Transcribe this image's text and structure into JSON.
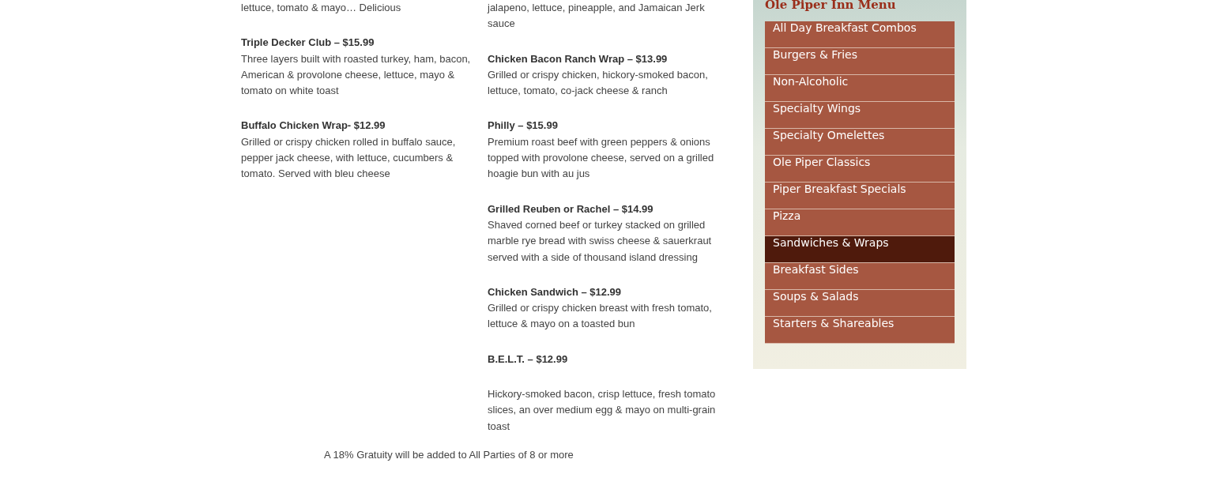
{
  "menu_columns": [
    {
      "items": [
        {
          "description": "lettuce, tomato & mayo… Delicious"
        },
        {
          "title": "Triple Decker Club – $15.99",
          "description": "Three layers built with roasted turkey, ham, bacon, American & provolone cheese, lettuce, mayo & tomato on white toast"
        },
        {
          "title": "Buffalo Chicken Wrap- $12.99",
          "description": "Grilled or crispy chicken rolled in buffalo sauce, pepper jack cheese, with lettuce, cucumbers & tomato. Served with bleu cheese"
        }
      ]
    },
    {
      "items": [
        {
          "description": "jalapeno, lettuce, pineapple, and Jamaican Jerk sauce"
        },
        {
          "title": "Chicken Bacon Ranch Wrap – $13.99",
          "description": "Grilled or crispy chicken, hickory-smoked bacon, lettuce, tomato, co-jack cheese & ranch"
        },
        {
          "title": "Philly – $15.99",
          "description": "Premium roast beef with green peppers & onions topped with provolone cheese, served on a grilled hoagie bun with au jus"
        },
        {
          "title": "Grilled Reuben or Rachel – $14.99",
          "description": "Shaved corned beef or turkey stacked on grilled marble rye bread with swiss cheese & sauerkraut served with a side of thousand island dressing"
        },
        {
          "title": "Chicken Sandwich – $12.99",
          "description": "Grilled or crispy chicken breast with fresh tomato, lettuce & mayo on a toasted bun"
        },
        {
          "title": "B.E.L.T. – $12.99"
        },
        {
          "description": "Hickory-smoked bacon, crisp lettuce, fresh tomato slices, an over medium egg & mayo on multi-grain toast"
        }
      ]
    }
  ],
  "footer_note": "A 18% Gratuity will be added to All Parties of 8 or more",
  "sidebar": {
    "title": "Ole Piper Inn Menu",
    "items": [
      {
        "label": "All Day Breakfast Combos",
        "selected": false
      },
      {
        "label": "Burgers & Fries",
        "selected": false
      },
      {
        "label": "Non-Alcoholic",
        "selected": false
      },
      {
        "label": "Specialty Wings",
        "selected": false
      },
      {
        "label": "Specialty Omelettes",
        "selected": false
      },
      {
        "label": "Ole Piper Classics",
        "selected": false
      },
      {
        "label": "Piper Breakfast Specials",
        "selected": false
      },
      {
        "label": "Pizza",
        "selected": false
      },
      {
        "label": "Sandwiches & Wraps",
        "selected": true
      },
      {
        "label": "Breakfast Sides",
        "selected": false
      },
      {
        "label": "Soups & Salads",
        "selected": false
      },
      {
        "label": "Starters & Shareables",
        "selected": false
      }
    ]
  }
}
